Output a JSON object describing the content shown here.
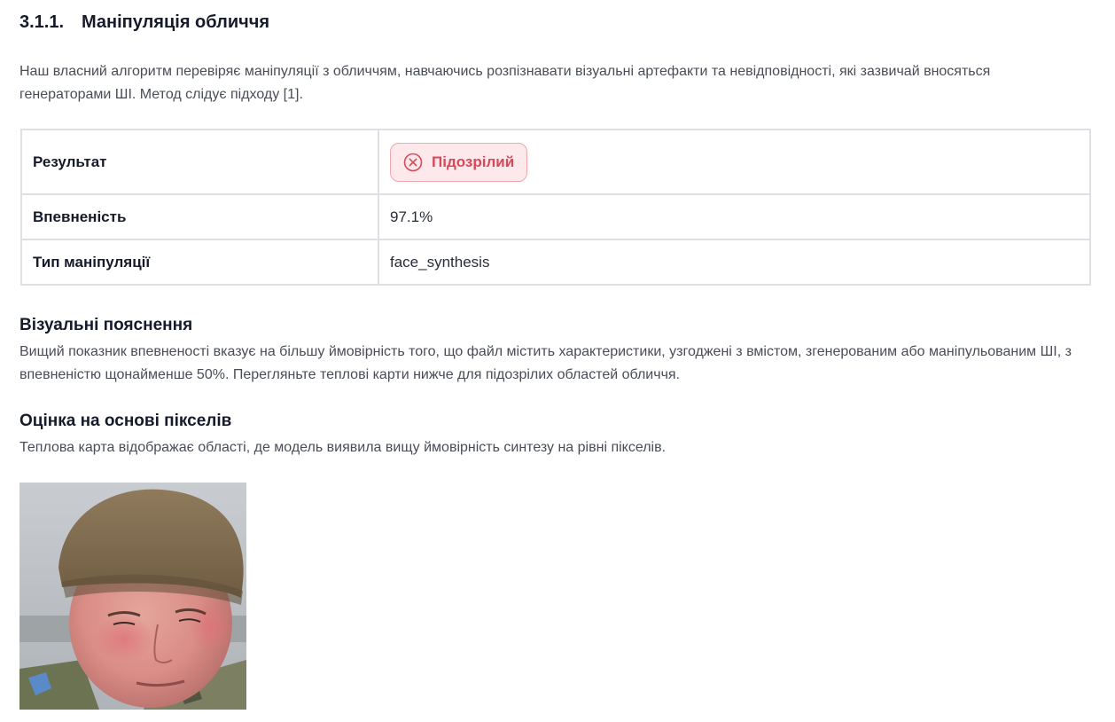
{
  "section": {
    "number": "3.1.1.",
    "title": "Маніпуляція обличчя",
    "intro": "Наш власний алгоритм перевіряє маніпуляції з обличчям, навчаючись розпізнавати візуальні артефакти та невідповідності, які зазвичай вносяться генераторами ШІ. Метод слідує підходу [1]."
  },
  "results": {
    "rows": [
      {
        "label": "Результат",
        "value": "Підозрілий",
        "badge_color": "#d8485a"
      },
      {
        "label": "Впевненість",
        "value": "97.1%"
      },
      {
        "label": "Тип маніпуляції",
        "value": "face_synthesis"
      }
    ]
  },
  "visual_explanations": {
    "title": "Візуальні пояснення",
    "text": "Вищий показник впевненості вказує на більшу ймовірність того, що файл містить характеристики, узгоджені з вмістом, згенерованим або маніпульованим ШІ, з впевненістю щонайменше 50%. Перегляньте теплові карти нижче для підозрілих областей обличчя."
  },
  "pixel_assessment": {
    "title": "Оцінка на основі пікселів",
    "text": "Теплова карта відображає області, де модель виявила вищу ймовірність синтезу на рівні пікселів."
  }
}
